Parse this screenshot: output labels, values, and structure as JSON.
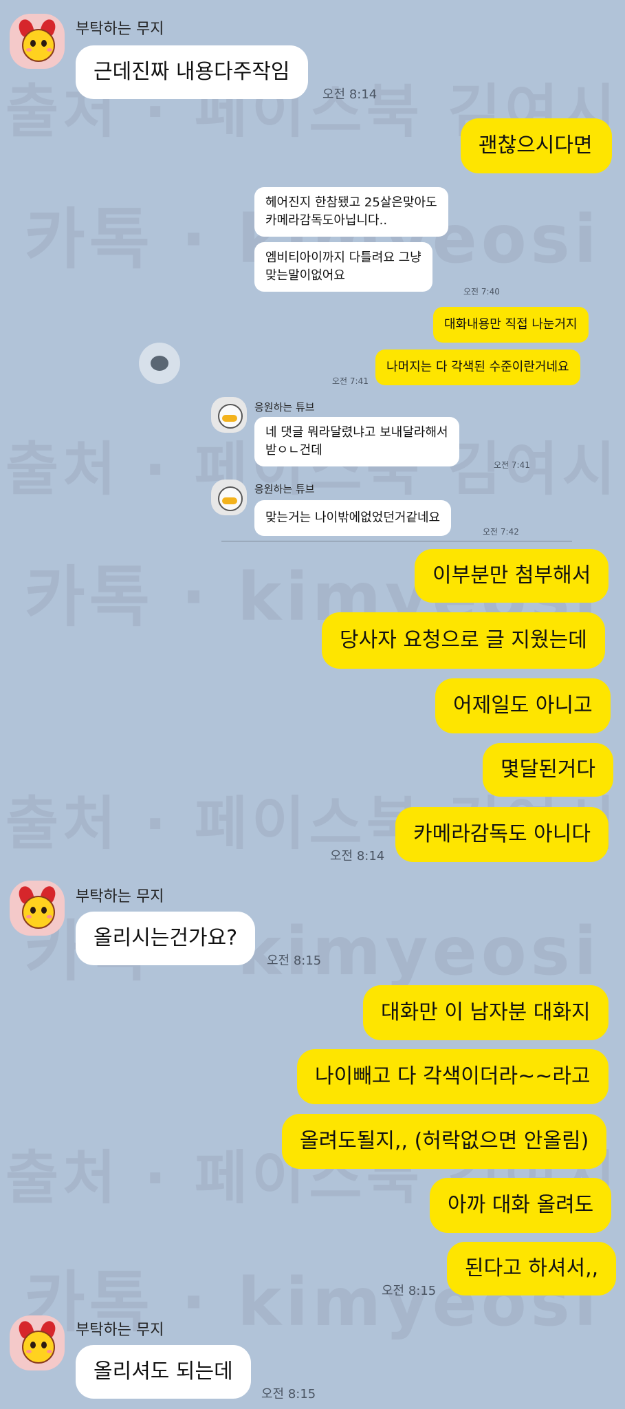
{
  "watermarks": {
    "line1": "출처 · 페이스북 김여시",
    "line2": "카톡 · kimyeosi"
  },
  "top": {
    "sender": "부탁하는 무지",
    "msg1": "근데진짜 내용다주작임",
    "time1": "오전 8:14",
    "mine1": "괜찮으시다면"
  },
  "embedded": {
    "w1": "헤어진지 한참됐고 25살은맞아도",
    "w1b": "카메라감독도아닙니다..",
    "w2": "엠비티아이까지 다틀려요 그냥",
    "w2b": "맞는말이없어요",
    "t1": "오전 7:40",
    "y1": "대화내용만 직접 나눈거지",
    "y2": "나머지는 다 각색된 수준이란거네요",
    "t2": "오전 7:41",
    "sender": "응원하는 튜브",
    "w3": "네 댓글 뭐라달렸냐고 보내달라해서",
    "w3b": "받ㅇㄴ건데",
    "t3": "오전 7:41",
    "w4": "맞는거는 나이밖에없었던거같네요",
    "t4": "오전 7:42"
  },
  "mid": {
    "m1": "이부분만 첨부해서",
    "m2": "당사자 요청으로 글 지웠는데",
    "m3": "어제일도 아니고",
    "m4": "몇달된거다",
    "m5": "카메라감독도 아니다",
    "time": "오전 8:14"
  },
  "muzi2": {
    "sender": "부탁하는 무지",
    "msg": "올리시는건가요?",
    "time": "오전 8:15"
  },
  "mine2": {
    "m1": "대화만 이 남자분 대화지",
    "m2": "나이빼고 다 각색이더라~~라고",
    "m3": "올려도될지,, (허락없으면 안올림)",
    "m4": "아까 대화 올려도",
    "m5": "된다고 하셔서,,",
    "time": "오전 8:15"
  },
  "muzi3": {
    "sender": "부탁하는 무지",
    "msg": "올리셔도 되는데",
    "time": "오전 8:15"
  },
  "colors": {
    "background": "#b1c3d8",
    "mine": "#fee500",
    "theirs": "#ffffff"
  }
}
